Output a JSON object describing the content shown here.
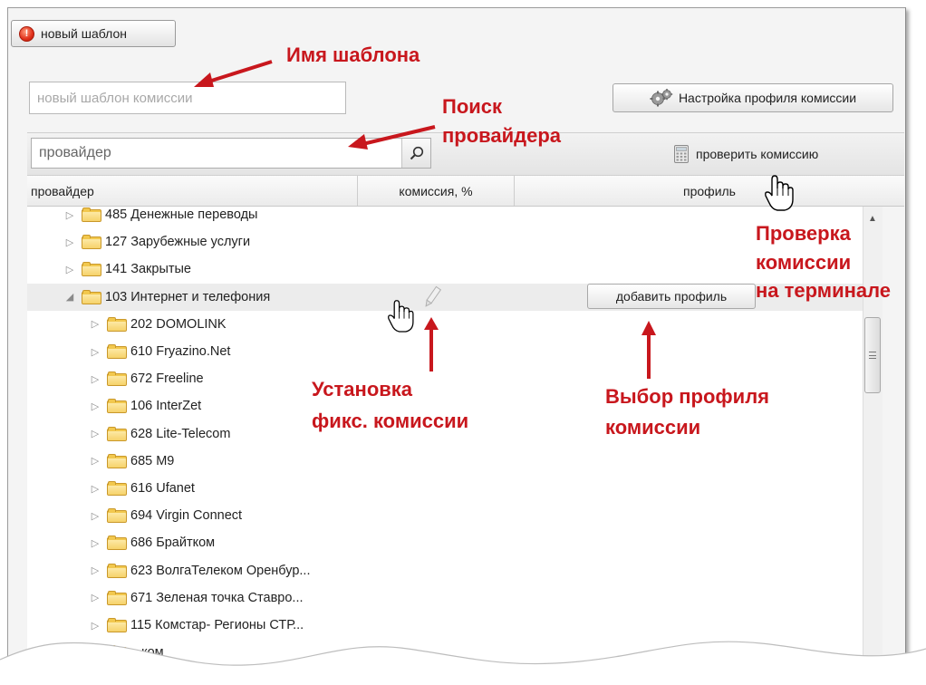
{
  "toolbar": {
    "tab_label": "новый шаблон",
    "name_placeholder": "новый шаблон комиссии",
    "profile_settings_label": "Настройка профиля комиссии",
    "search_placeholder": "провайдер",
    "check_commission_label": "проверить комиссию"
  },
  "columns": {
    "provider": "провайдер",
    "commission": "комиссия, %",
    "profile": "профиль"
  },
  "tree": {
    "rows": [
      {
        "label": "485 Денежные переводы",
        "level": 0,
        "expanded": false
      },
      {
        "label": "127 Зарубежные услуги",
        "level": 0,
        "expanded": false
      },
      {
        "label": "141 Закрытые",
        "level": 0,
        "expanded": false
      },
      {
        "label": "103 Интернет и телефония",
        "level": 0,
        "expanded": true,
        "selected": true
      },
      {
        "label": "202 DOMOLINK",
        "level": 1,
        "expanded": false
      },
      {
        "label": "610 Fryazino.Net",
        "level": 1,
        "expanded": false
      },
      {
        "label": "672 Freeline",
        "level": 1,
        "expanded": false
      },
      {
        "label": "106 InterZet",
        "level": 1,
        "expanded": false
      },
      {
        "label": "628 Lite-Telecom",
        "level": 1,
        "expanded": false
      },
      {
        "label": "685 M9",
        "level": 1,
        "expanded": false
      },
      {
        "label": "616 Ufanet",
        "level": 1,
        "expanded": false
      },
      {
        "label": "694 Virgin Connect",
        "level": 1,
        "expanded": false
      },
      {
        "label": "686 Брайтком",
        "level": 1,
        "expanded": false
      },
      {
        "label": "623 ВолгаТелеком Оренбур...",
        "level": 1,
        "expanded": false
      },
      {
        "label": "671 Зеленая точка Ставро...",
        "level": 1,
        "expanded": false
      },
      {
        "label": "115 Комстар- Регионы СТР...",
        "level": 1,
        "expanded": false
      },
      {
        "label": "...ком",
        "level": 1,
        "expanded": false
      }
    ],
    "add_profile_label": "добавить профиль"
  },
  "annotations": {
    "template_name": "Имя шаблона",
    "provider_search_1": "Поиск",
    "provider_search_2": "провайдера",
    "check_commission_1": "Проверка",
    "check_commission_2": "комиссии",
    "check_commission_3": "на терминале",
    "fixed_commission_1": "Установка",
    "fixed_commission_2": "фикс. комиссии",
    "profile_choice_1": "Выбор профиля",
    "profile_choice_2": "комиссии"
  },
  "colors": {
    "annotation": "#c8171d",
    "folder": "#f2c84e"
  },
  "icons": {
    "tab": "error-icon",
    "profile_settings": "gears-icon",
    "search": "magnifier-icon",
    "check": "calculator-icon",
    "fixed_commission": "pencil-icon",
    "cursor": "hand-cursor-icon"
  }
}
